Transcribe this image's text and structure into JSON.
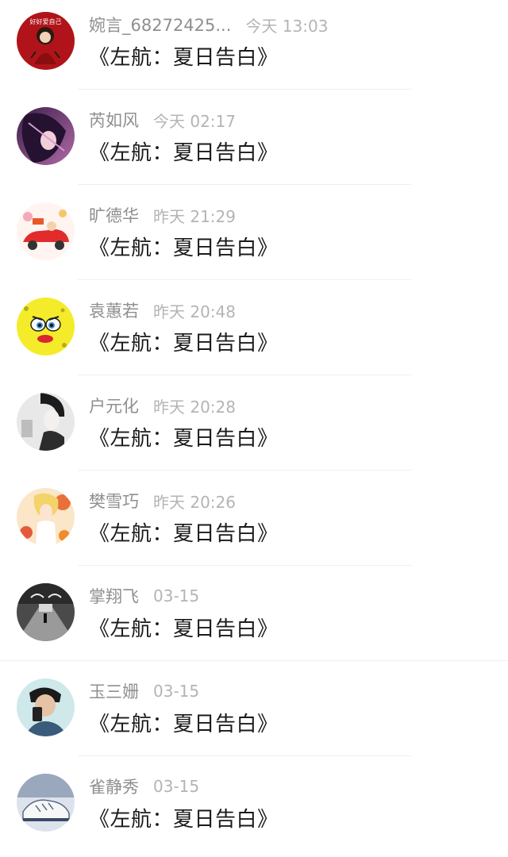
{
  "comments": [
    {
      "username": "婉言_68272425...",
      "time": "今天 13:03",
      "text": "《左航：夏日告白》",
      "avatar_icon": "red-cartoon-girl-avatar",
      "avatar_caption": "好好爱自己"
    },
    {
      "username": "芮如风",
      "time": "今天 02:17",
      "text": "《左航：夏日告白》",
      "avatar_icon": "purple-anime-girl-avatar"
    },
    {
      "username": "旷德华",
      "time": "昨天 21:29",
      "text": "《左航：夏日告白》",
      "avatar_icon": "red-cartoon-car-avatar"
    },
    {
      "username": "袁蕙若",
      "time": "昨天 20:48",
      "text": "《左航：夏日告白》",
      "avatar_icon": "yellow-sponge-face-avatar"
    },
    {
      "username": "户元化",
      "time": "昨天 20:28",
      "text": "《左航：夏日告白》",
      "avatar_icon": "monochrome-anime-man-avatar"
    },
    {
      "username": "樊雪巧",
      "time": "昨天 20:26",
      "text": "《左航：夏日告白》",
      "avatar_icon": "autumn-anime-girl-avatar"
    },
    {
      "username": "掌翔飞",
      "time": "03-15",
      "text": "《左航：夏日告白》",
      "avatar_icon": "dark-hallway-avatar"
    },
    {
      "username": "玉三姗",
      "time": "03-15",
      "text": "《左航：夏日告白》",
      "avatar_icon": "boy-with-phone-avatar"
    },
    {
      "username": "雀静秀",
      "time": "03-15",
      "text": "《左航：夏日告白》",
      "avatar_icon": "sneaker-photo-avatar"
    }
  ]
}
